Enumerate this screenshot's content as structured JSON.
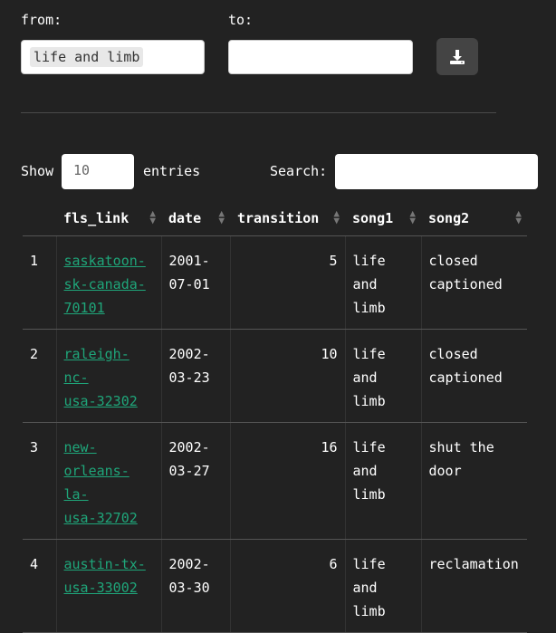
{
  "filters": {
    "from_label": "from:",
    "from_value": "life and limb",
    "to_label": "to:",
    "to_value": ""
  },
  "download": {
    "icon": "download-icon"
  },
  "table_controls": {
    "show_label": "Show",
    "length_value": "10",
    "entries_label": "entries",
    "search_label": "Search:",
    "search_value": ""
  },
  "table": {
    "columns": [
      "",
      "fls_link",
      "date",
      "transition",
      "song1",
      "song2"
    ],
    "rows": [
      {
        "index": "1",
        "fls_link": "saskatoon-sk-canada-70101",
        "link_lines": [
          "saskatoon-",
          "sk-canada-",
          "70101"
        ],
        "date_lines": [
          "2001-",
          "07-01"
        ],
        "transition": "5",
        "song1_lines": [
          "life",
          "and",
          "limb"
        ],
        "song2_lines": [
          "closed",
          "captioned"
        ]
      },
      {
        "index": "2",
        "fls_link": "raleigh-nc-usa-32302",
        "link_lines": [
          "raleigh-nc-",
          "usa-32302"
        ],
        "date_lines": [
          "2002-",
          "03-23"
        ],
        "transition": "10",
        "song1_lines": [
          "life",
          "and",
          "limb"
        ],
        "song2_lines": [
          "closed",
          "captioned"
        ]
      },
      {
        "index": "3",
        "fls_link": "new-orleans-la-usa-32702",
        "link_lines": [
          "new-",
          "orleans-la-",
          "usa-32702"
        ],
        "date_lines": [
          "2002-",
          "03-27"
        ],
        "transition": "16",
        "song1_lines": [
          "life",
          "and",
          "limb"
        ],
        "song2_lines": [
          "shut the",
          "door"
        ]
      },
      {
        "index": "4",
        "fls_link": "austin-tx-usa-33002",
        "link_lines": [
          "austin-tx-",
          "usa-33002"
        ],
        "date_lines": [
          "2002-",
          "03-30"
        ],
        "transition": "6",
        "song1_lines": [
          "life",
          "and",
          "limb"
        ],
        "song2_lines": [
          "reclamation"
        ]
      }
    ]
  },
  "colors": {
    "background": "#222222",
    "link": "#1fa67a",
    "button": "#444444"
  }
}
